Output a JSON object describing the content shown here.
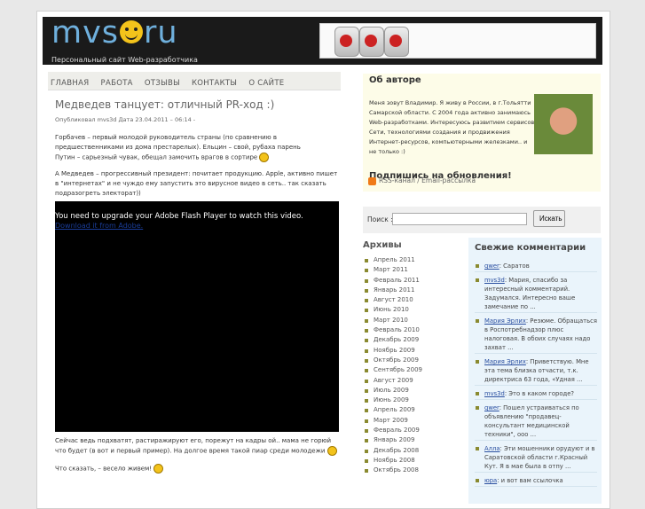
{
  "header": {
    "logo_part1": "mvs",
    "logo_part2": "ru",
    "tagline": "Персональный сайт Web-разработчика"
  },
  "nav": [
    "ГЛАВНАЯ",
    "РАБОТА",
    "ОТЗЫВЫ",
    "КОНТАКТЫ",
    "О САЙТЕ"
  ],
  "post": {
    "title": "Медведев танцует: отличный PR-ход :)",
    "meta_prefix": "Опубликовал",
    "meta_author": "mvs3d",
    "meta_date_label": "Дата",
    "meta_date": "23.04.2011 – 06:14",
    "meta_suffix": " -",
    "p1": "Горбачев – первый молодой руководитель страны (по сравнению в предшественниками из дома престарелых). Ельцин – свой, рубаха парень ",
    "p1b": "Путин – сарьезный чувак, обещал замочить врагов в сортире",
    "p2": "А Медведев – прогрессивный президент: почитает продукцию. Apple, активно пишет в \"интернетах\" и не чуждо ему запустить это вирусное видео в сеть.. так сказать подразогреть электорат))",
    "video_msg": "You need to upgrade your Adobe Flash Player to watch this video.",
    "video_link": "Download it from Adobe.",
    "p3": "Сейчас ведь подхватят, растиражируют его, порежут на кадры ой.. мама не горюй что будет (в вот и первый пример). На долгое время такой пиар среди молодежи",
    "p4": "Что сказать, – весело живем!"
  },
  "about": {
    "title": "Об авторе",
    "text": "Меня зовут Владимир. Я живу в России, в г.Тольятти Самарской области. С 2004 года активно занимаюсь Web-разработками. Интересуюсь развитием сервисов Сети, технологиями создания и продвижения Интернет-ресурсов, компьютерными железками.. и не только :)",
    "subscribe": "Подпишись на обновления!",
    "rss": "RSS-канал / Email-рассылка"
  },
  "search": {
    "label": "Поиск :",
    "button": "Искать",
    "placeholder": ""
  },
  "archives": {
    "title": "Архивы",
    "items": [
      "Апрель 2011",
      "Март 2011",
      "Февраль 2011",
      "Январь 2011",
      "Август 2010",
      "Июнь 2010",
      "Март 2010",
      "Февраль 2010",
      "Декабрь 2009",
      "Ноябрь 2009",
      "Октябрь 2009",
      "Сентябрь 2009",
      "Август 2009",
      "Июль 2009",
      "Июнь 2009",
      "Апрель 2009",
      "Март 2009",
      "Февраль 2009",
      "Январь 2009",
      "Декабрь 2008",
      "Ноябрь 2008",
      "Октябрь 2008"
    ]
  },
  "comments": {
    "title": "Свежие комментарии",
    "items": [
      {
        "author": "qwer",
        "text": ": Саратов"
      },
      {
        "author": "mvs3d",
        "text": ": Мария, спасибо за интересный комментарий. Задумался. Интересно ваше замечание по ..."
      },
      {
        "author": "Мария Эрлих",
        "text": ": Резюме. Обращаться в Роспотребнадзор плюс налоговая. В обоих случаях надо захват ..."
      },
      {
        "author": "Мария Эрлих",
        "text": ": Приветствую. Мне эта тема близка отчасти, т.к. директриса 63 года, «Удная ..."
      },
      {
        "author": "mvs3d",
        "text": ": Это в каком городе?"
      },
      {
        "author": "qwer",
        "text": ": Пошел устраиваться по объявлению \"продавец-консультант медицинской техники\", ооо ..."
      },
      {
        "author": "Алла",
        "text": ": Эти мошенники орудуют и в Саратовской области г.Красный Кут. Я в мае была в отпу ..."
      },
      {
        "author": "юра",
        "text": ": и вот вам ссылочка"
      }
    ]
  }
}
